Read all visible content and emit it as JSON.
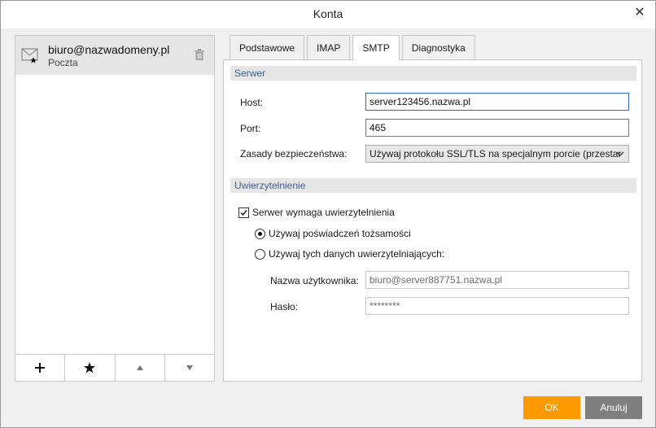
{
  "window": {
    "title": "Konta"
  },
  "accounts": [
    {
      "name": "biuro@nazwadomeny.pl",
      "type": "Poczta"
    }
  ],
  "tabs": [
    {
      "label": "Podstawowe"
    },
    {
      "label": "IMAP"
    },
    {
      "label": "SMTP"
    },
    {
      "label": "Diagnostyka"
    }
  ],
  "server": {
    "section_title": "Serwer",
    "host_label": "Host:",
    "host_value": "server123456.nazwa.pl",
    "port_label": "Port:",
    "port_value": "465",
    "security_label": "Zasady bezpieczeństwa:",
    "security_value": "Używaj protokołu SSL/TLS na specjalnym porcie (przestar"
  },
  "auth": {
    "section_title": "Uwierzytelnienie",
    "requires_auth_label": "Serwer wymaga uwierzytelnienia",
    "use_identity_label": "Używaj poświadczeń tożsamości",
    "use_these_label": "Używaj tych danych uwierzytelniających:",
    "username_label": "Nazwa użytkownika:",
    "username_value": "biuro@server887751.nazwa.pl",
    "password_label": "Hasło:",
    "password_value": "********"
  },
  "buttons": {
    "ok": "OK",
    "cancel": "Anuluj"
  },
  "colors": {
    "accent": "#ff9900",
    "section_text": "#3d5f8f",
    "cancel": "#7f7f7f"
  }
}
